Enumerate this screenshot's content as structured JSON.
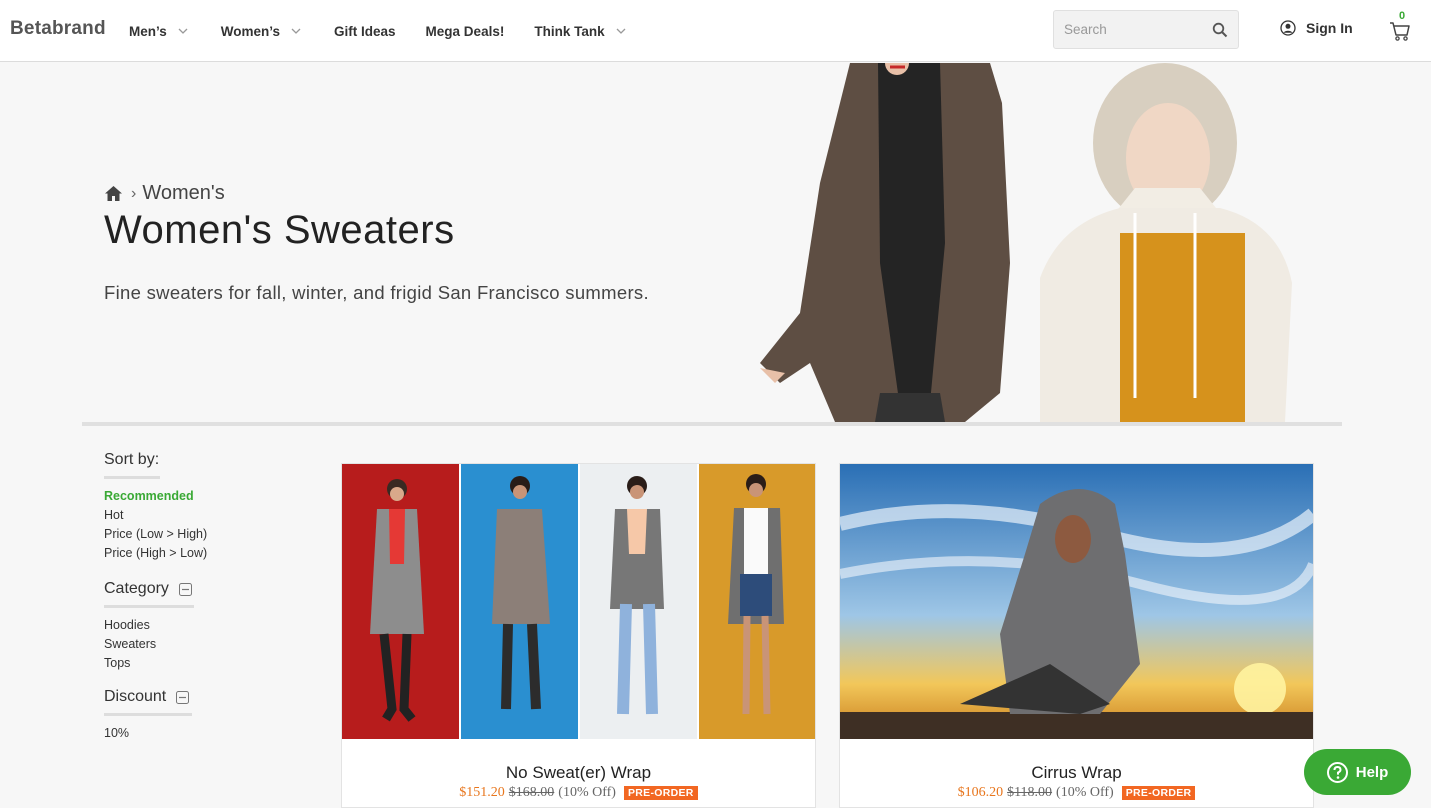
{
  "header": {
    "logo": "Betabrand",
    "nav": [
      {
        "label": "Men’s"
      },
      {
        "label": "Women’s"
      },
      {
        "label": "Gift Ideas"
      },
      {
        "label": "Mega Deals!"
      },
      {
        "label": "Think Tank"
      }
    ],
    "search_placeholder": "Search",
    "signin_label": "Sign In",
    "cart_count": "0"
  },
  "hero": {
    "breadcrumb_sep": "›",
    "breadcrumb_parent": "Women's",
    "title": "Women's Sweaters",
    "description": "Fine sweaters for fall, winter, and frigid San Francisco summers."
  },
  "filters": {
    "sort_title": "Sort by:",
    "sort_options": [
      "Recommended",
      "Hot",
      "Price (Low > High)",
      "Price (High > Low)"
    ],
    "category_title": "Category",
    "category_options": [
      "Hoodies",
      "Sweaters",
      "Tops"
    ],
    "discount_title": "Discount",
    "discount_options": [
      "10%"
    ]
  },
  "products": [
    {
      "name": "No Sweat(er) Wrap",
      "sale_price": "$151.20",
      "orig_price": "$168.00",
      "discount": "(10% Off)",
      "badge": "PRE-ORDER"
    },
    {
      "name": "Cirrus Wrap",
      "sale_price": "$106.20",
      "orig_price": "$118.00",
      "discount": "(10% Off)",
      "badge": "PRE-ORDER"
    }
  ],
  "help_label": "Help",
  "colors": {
    "accent_green": "#3aa935",
    "sale_orange": "#e8761d",
    "badge_orange": "#f26722"
  }
}
